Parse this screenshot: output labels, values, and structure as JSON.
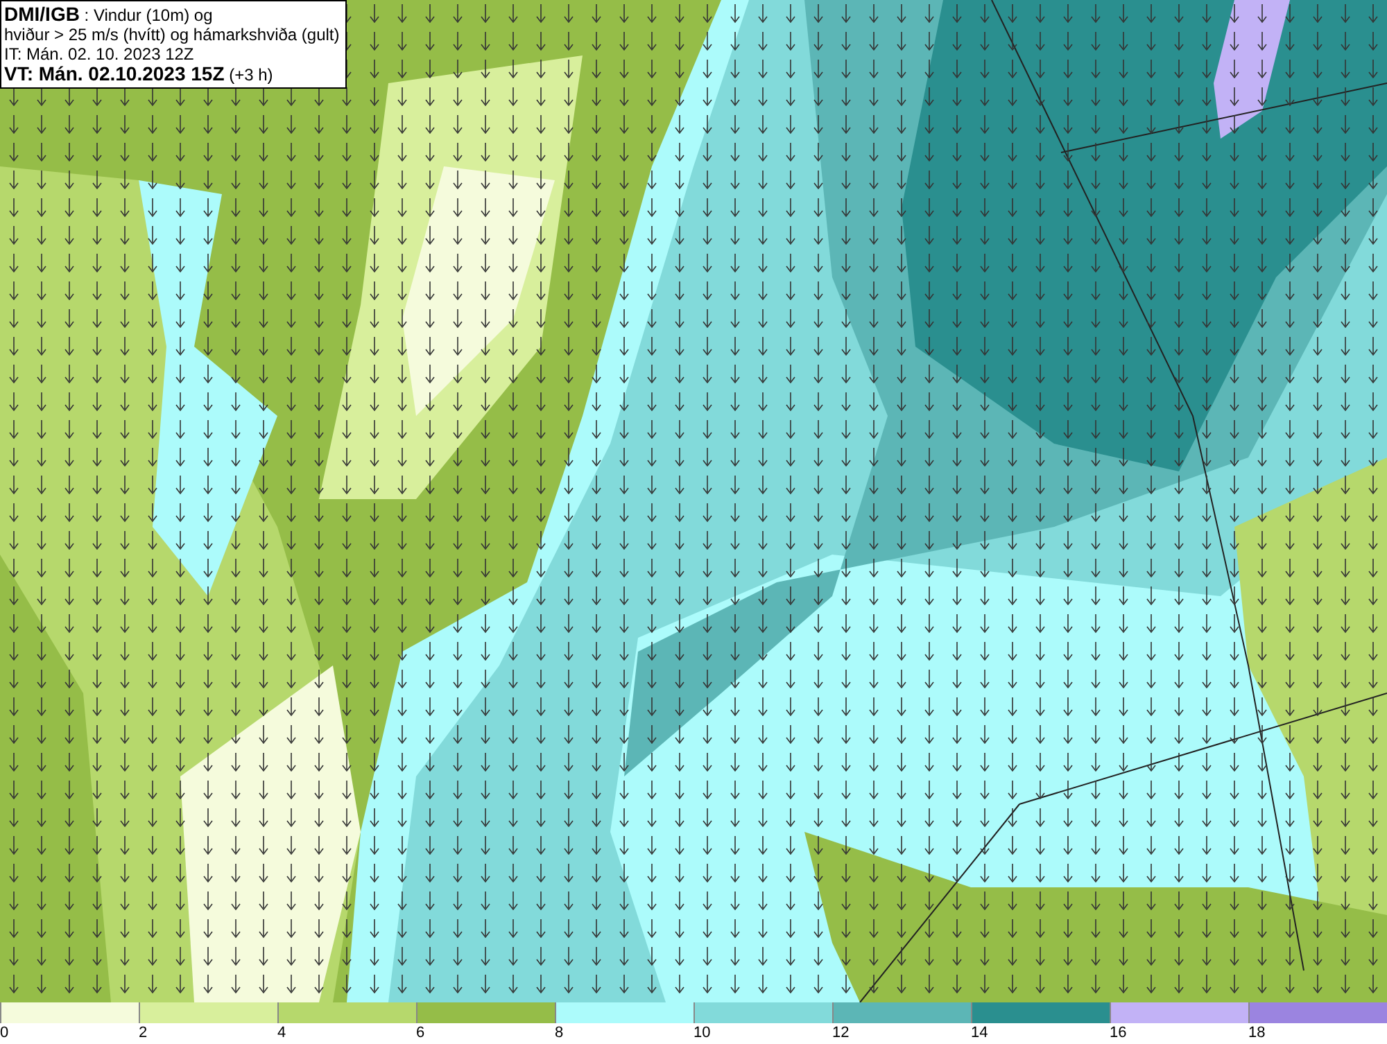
{
  "header": {
    "lines": [
      "**DMI/IGB** : Vindur (10m) og",
      "hviður > 25 m/s (hvítt) og hámarkshviða (gult)",
      "IT: Mán. 02. 10. 2023 12Z",
      "**VT: Mán. 02.10.2023 15Z** (+3 h)"
    ]
  },
  "legend": {
    "segments": [
      {
        "label": "0",
        "color": "#f5fbdc"
      },
      {
        "label": "2",
        "color": "#d8ef9c"
      },
      {
        "label": "4",
        "color": "#b6d86c"
      },
      {
        "label": "6",
        "color": "#95bd48"
      },
      {
        "label": "8",
        "color": "#acfbfb"
      },
      {
        "label": "10",
        "color": "#82dada"
      },
      {
        "label": "12",
        "color": "#5cb6b6"
      },
      {
        "label": "14",
        "color": "#2a8f8f"
      },
      {
        "label": "16",
        "color": "#c2b2f6"
      },
      {
        "label": "18",
        "color": "#9b84e0"
      }
    ]
  }
}
